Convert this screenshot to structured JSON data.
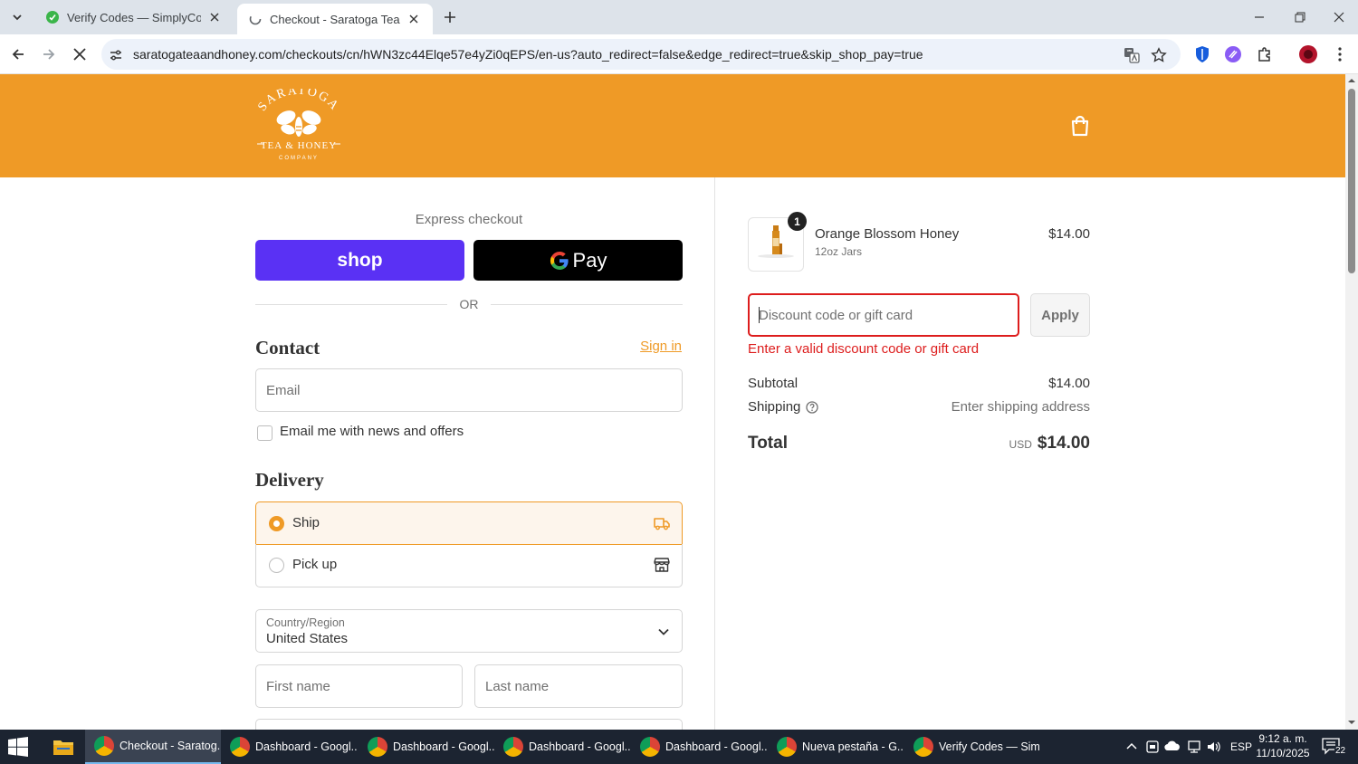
{
  "browser": {
    "tabs": [
      {
        "title": "Verify Codes — SimplyCodes",
        "active": false
      },
      {
        "title": "Checkout - Saratoga Tea & Hon",
        "active": true
      }
    ],
    "url": "saratogateaandhoney.com/checkouts/cn/hWN3zc44Elqe57e4yZi0qEPS/en-us?auto_redirect=false&edge_redirect=true&skip_shop_pay=true"
  },
  "header": {
    "logo_text": "SARATOGA TEA & HONEY COMPANY",
    "brand_color": "#ef9a26"
  },
  "express": {
    "label": "Express checkout",
    "shop_label": "shop",
    "gpay_label": "Pay",
    "or_label": "OR"
  },
  "contact": {
    "title": "Contact",
    "signin_label": "Sign in",
    "email_placeholder": "Email",
    "newsletter_label": "Email me with news and offers"
  },
  "delivery": {
    "title": "Delivery",
    "options": [
      {
        "label": "Ship",
        "selected": true
      },
      {
        "label": "Pick up",
        "selected": false
      }
    ],
    "country_label": "Country/Region",
    "country_value": "United States",
    "first_name_placeholder": "First name",
    "last_name_placeholder": "Last name"
  },
  "summary": {
    "item": {
      "qty": "1",
      "name": "Orange Blossom Honey",
      "variant": "12oz Jars",
      "price": "$14.00"
    },
    "discount_placeholder": "Discount code or gift card",
    "apply_label": "Apply",
    "error": "Enter a valid discount code or gift card",
    "subtotal_label": "Subtotal",
    "subtotal_value": "$14.00",
    "shipping_label": "Shipping",
    "shipping_value": "Enter shipping address",
    "total_label": "Total",
    "currency": "USD",
    "total_value": "$14.00",
    "error_color": "#dd1d1d"
  },
  "taskbar": {
    "items": [
      {
        "label": "Checkout - Saratog...",
        "active": true
      },
      {
        "label": "Dashboard - Googl...",
        "active": false
      },
      {
        "label": "Dashboard - Googl...",
        "active": false
      },
      {
        "label": "Dashboard - Googl...",
        "active": false
      },
      {
        "label": "Dashboard - Googl...",
        "active": false
      },
      {
        "label": "Nueva pestaña - G...",
        "active": false
      },
      {
        "label": "Verify Codes — Sim...",
        "active": false
      }
    ],
    "lang": "ESP",
    "time": "9:12 a. m.",
    "date": "11/10/2025",
    "notifications": "22"
  }
}
